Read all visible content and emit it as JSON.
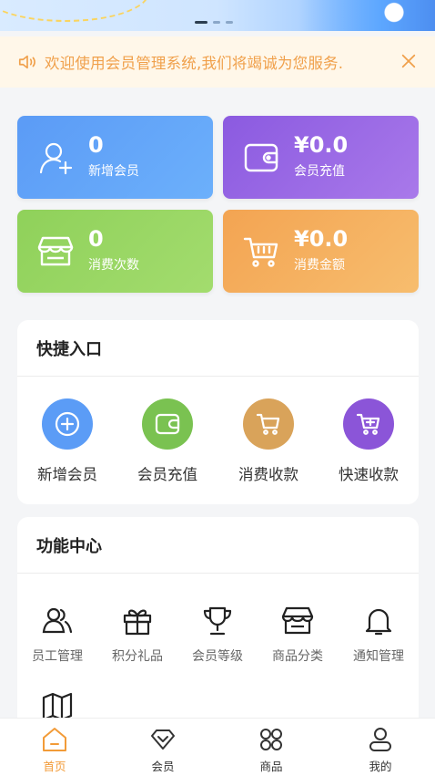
{
  "notice": {
    "text": "欢迎使用会员管理系统,我们将竭诚为您服务."
  },
  "stats": {
    "new_members": {
      "value": "0",
      "label": "新增会员"
    },
    "member_recharge": {
      "value": "¥0.0",
      "label": "会员充值"
    },
    "consume_count": {
      "value": "0",
      "label": "消费次数"
    },
    "consume_amount": {
      "value": "¥0.0",
      "label": "消费金额"
    }
  },
  "quick": {
    "title": "快捷入口",
    "items": [
      {
        "label": "新增会员",
        "icon": "plus-circle-icon",
        "color": "#5b9cf6"
      },
      {
        "label": "会员充值",
        "icon": "wallet-icon",
        "color": "#7ac251"
      },
      {
        "label": "消费收款",
        "icon": "cart-icon",
        "color": "#d9a35a"
      },
      {
        "label": "快速收款",
        "icon": "cart-fast-icon",
        "color": "#8b55d8"
      }
    ]
  },
  "functions": {
    "title": "功能中心",
    "items": [
      {
        "label": "员工管理",
        "icon": "staff-icon"
      },
      {
        "label": "积分礼品",
        "icon": "gift-icon"
      },
      {
        "label": "会员等级",
        "icon": "trophy-icon"
      },
      {
        "label": "商品分类",
        "icon": "store-icon"
      },
      {
        "label": "通知管理",
        "icon": "bell-icon"
      },
      {
        "label": "",
        "icon": "map-icon"
      }
    ]
  },
  "tabs": [
    {
      "label": "首页",
      "icon": "home-icon",
      "active": true
    },
    {
      "label": "会员",
      "icon": "diamond-icon",
      "active": false
    },
    {
      "label": "商品",
      "icon": "grid-icon",
      "active": false
    },
    {
      "label": "我的",
      "icon": "user-icon",
      "active": false
    }
  ],
  "colors": {
    "accent": "#f29b38",
    "notice_text": "#f0a04b"
  }
}
